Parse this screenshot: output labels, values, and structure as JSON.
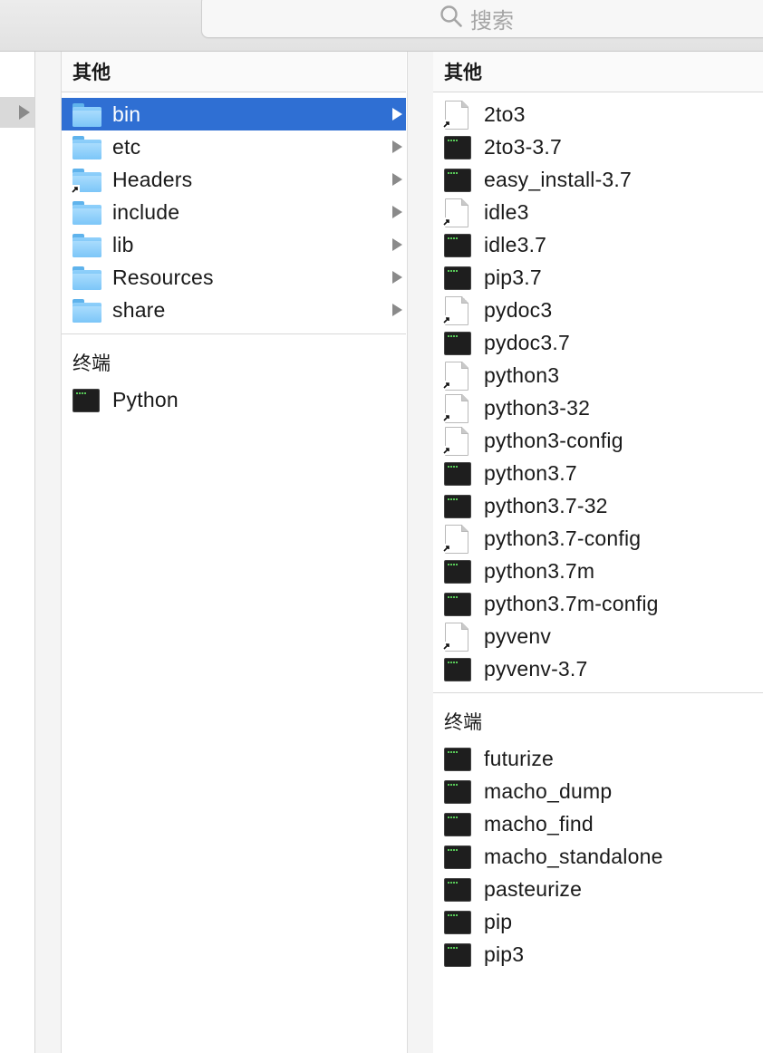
{
  "toolbar": {
    "search_placeholder": "搜索",
    "search_icon": "search-icon"
  },
  "colors": {
    "selection": "#2f6fd3",
    "folder": "#7cc6f8",
    "terminal_text": "#58c858"
  },
  "column1": {
    "header_other": "其他",
    "folders": [
      {
        "label": "bin",
        "icon": "folder-icon",
        "selected": true,
        "alias": false
      },
      {
        "label": "etc",
        "icon": "folder-icon",
        "selected": false,
        "alias": false
      },
      {
        "label": "Headers",
        "icon": "folder-icon",
        "selected": false,
        "alias": true
      },
      {
        "label": "include",
        "icon": "folder-icon",
        "selected": false,
        "alias": false
      },
      {
        "label": "lib",
        "icon": "folder-icon",
        "selected": false,
        "alias": false
      },
      {
        "label": "Resources",
        "icon": "folder-icon",
        "selected": false,
        "alias": false
      },
      {
        "label": "share",
        "icon": "folder-icon",
        "selected": false,
        "alias": false
      }
    ],
    "header_terminal": "终端",
    "terminal_items": [
      {
        "label": "Python",
        "icon": "terminal-icon"
      }
    ]
  },
  "column2": {
    "header_other": "其他",
    "other_items": [
      {
        "label": "2to3",
        "icon": "alias-icon"
      },
      {
        "label": "2to3-3.7",
        "icon": "terminal-icon"
      },
      {
        "label": "easy_install-3.7",
        "icon": "terminal-icon"
      },
      {
        "label": "idle3",
        "icon": "alias-icon"
      },
      {
        "label": "idle3.7",
        "icon": "terminal-icon"
      },
      {
        "label": "pip3.7",
        "icon": "terminal-icon"
      },
      {
        "label": "pydoc3",
        "icon": "alias-icon"
      },
      {
        "label": "pydoc3.7",
        "icon": "terminal-icon"
      },
      {
        "label": "python3",
        "icon": "alias-icon"
      },
      {
        "label": "python3-32",
        "icon": "alias-icon"
      },
      {
        "label": "python3-config",
        "icon": "alias-icon"
      },
      {
        "label": "python3.7",
        "icon": "terminal-icon"
      },
      {
        "label": "python3.7-32",
        "icon": "terminal-icon"
      },
      {
        "label": "python3.7-config",
        "icon": "alias-icon"
      },
      {
        "label": "python3.7m",
        "icon": "terminal-icon"
      },
      {
        "label": "python3.7m-config",
        "icon": "terminal-icon"
      },
      {
        "label": "pyvenv",
        "icon": "alias-icon"
      },
      {
        "label": "pyvenv-3.7",
        "icon": "terminal-icon"
      }
    ],
    "header_terminal": "终端",
    "terminal_items": [
      {
        "label": "futurize",
        "icon": "terminal-icon"
      },
      {
        "label": "macho_dump",
        "icon": "terminal-icon"
      },
      {
        "label": "macho_find",
        "icon": "terminal-icon"
      },
      {
        "label": "macho_standalone",
        "icon": "terminal-icon"
      },
      {
        "label": "pasteurize",
        "icon": "terminal-icon"
      },
      {
        "label": "pip",
        "icon": "terminal-icon"
      },
      {
        "label": "pip3",
        "icon": "terminal-icon"
      }
    ]
  }
}
